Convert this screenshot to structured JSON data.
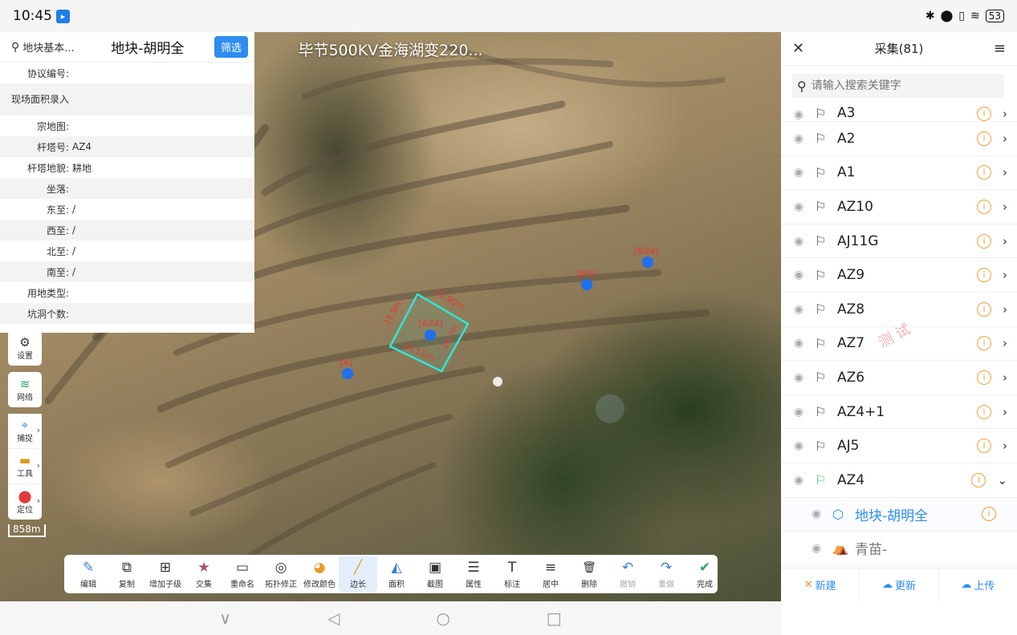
{
  "status": {
    "time": "10:45",
    "battery": "53",
    "icons": "✱ ⬤ ▯ ≋"
  },
  "map": {
    "title": "毕节500KV金海湖变220...",
    "scale": "858m",
    "markers": [
      {
        "label": "[BZ4]"
      },
      {
        "label": "[B4]"
      },
      {
        "label": "[AZ4]"
      },
      {
        "label": "[A]"
      }
    ],
    "edge_labels": [
      "13.90m",
      "14.11m",
      "15.9m",
      "14.7m"
    ]
  },
  "info": {
    "crumb": "地块基本...",
    "title": "地块-胡明全",
    "filter_label": "筛选",
    "rows": [
      {
        "k": "协议编号:",
        "v": ""
      },
      {
        "k": "现场面积录入",
        "v": ""
      },
      {
        "k": "宗地图:",
        "v": ""
      },
      {
        "k": "杆塔号:",
        "v": "AZ4"
      },
      {
        "k": "杆塔地貌:",
        "v": "耕地"
      },
      {
        "k": "坐落:",
        "v": ""
      },
      {
        "k": "东至:",
        "v": "/"
      },
      {
        "k": "西至:",
        "v": "/"
      },
      {
        "k": "北至:",
        "v": "/"
      },
      {
        "k": "南至:",
        "v": "/"
      },
      {
        "k": "用地类型:",
        "v": ""
      },
      {
        "k": "坑洞个数:",
        "v": ""
      }
    ]
  },
  "lefttools": [
    {
      "label": "设置",
      "icon": "gear-icon"
    },
    {
      "label": "网络",
      "icon": "wifi-icon"
    },
    {
      "label": "捕捉",
      "icon": "capture-icon"
    },
    {
      "label": "工具",
      "icon": "toolbox-icon"
    },
    {
      "label": "定位",
      "icon": "location-icon"
    }
  ],
  "toolbar": [
    {
      "label": "编辑",
      "icon": "✎"
    },
    {
      "label": "复制",
      "icon": "⧉"
    },
    {
      "label": "增加子级",
      "icon": "⊞"
    },
    {
      "label": "交集",
      "icon": "★"
    },
    {
      "label": "重命名",
      "icon": "▭"
    },
    {
      "label": "拓扑修正",
      "icon": "◎"
    },
    {
      "label": "修改颜色",
      "icon": "◕"
    },
    {
      "label": "边长",
      "icon": "╱"
    },
    {
      "label": "面积",
      "icon": "◭"
    },
    {
      "label": "截图",
      "icon": "▣"
    },
    {
      "label": "属性",
      "icon": "☰"
    },
    {
      "label": "标注",
      "icon": "T"
    },
    {
      "label": "居中",
      "icon": "≡"
    },
    {
      "label": "删除",
      "icon": "🗑"
    },
    {
      "label": "撤销",
      "icon": "↶"
    },
    {
      "label": "重做",
      "icon": "↷"
    },
    {
      "label": "完成",
      "icon": "✔"
    }
  ],
  "nav": {
    "back": "◁",
    "home": "○",
    "recent": "□",
    "down": "∨"
  },
  "panel": {
    "title": "采集(81)",
    "search_placeholder": "请输入搜索关键字",
    "items": [
      {
        "name": "A3"
      },
      {
        "name": "A2"
      },
      {
        "name": "A1"
      },
      {
        "name": "AZ10"
      },
      {
        "name": "AJ11G"
      },
      {
        "name": "AZ9"
      },
      {
        "name": "AZ8"
      },
      {
        "name": "AZ7"
      },
      {
        "name": "AZ6"
      },
      {
        "name": "AZ4+1"
      },
      {
        "name": "AJ5"
      },
      {
        "name": "AZ4"
      }
    ],
    "children": [
      {
        "name": "地块-胡明全"
      },
      {
        "name": "青苗-"
      }
    ],
    "watermark": "测 试",
    "buttons": {
      "new": "新建",
      "update": "更新",
      "upload": "上传"
    }
  }
}
